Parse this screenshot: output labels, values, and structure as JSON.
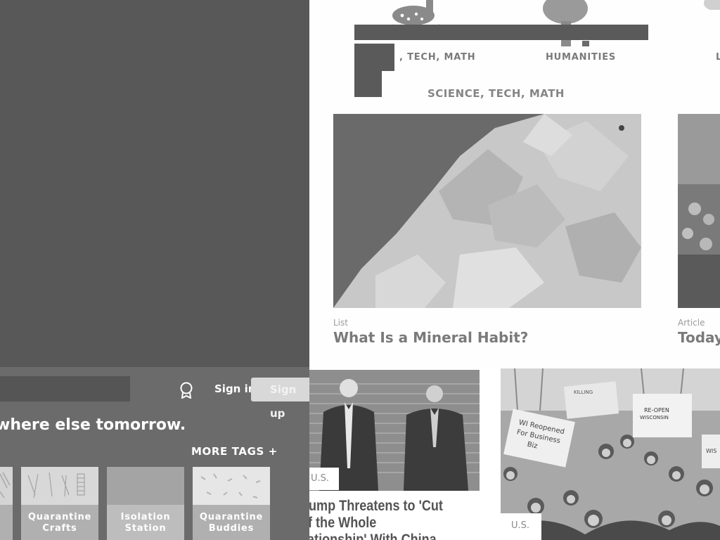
{
  "categories": [
    {
      "label": ", TECH, MATH"
    },
    {
      "label": "HUMANITIES"
    },
    {
      "label": "L"
    }
  ],
  "section_title": "SCIENCE, TECH, MATH",
  "cards": [
    {
      "type": "List",
      "title": "What Is a Mineral Habit?"
    },
    {
      "type": "Article",
      "title": "Today"
    }
  ],
  "bottom_header": {
    "sign_in": "Sign in",
    "sign_up": "Sign up",
    "tagline": "where else tomorrow.",
    "more_tags": "MORE TAGS +"
  },
  "tags": [
    {
      "label_line1": "",
      "label_line2": ""
    },
    {
      "label_line1": "Quarantine",
      "label_line2": "Crafts"
    },
    {
      "label_line1": "Isolation",
      "label_line2": "Station"
    },
    {
      "label_line1": "Quarantine",
      "label_line2": "Buddies"
    }
  ],
  "news": [
    {
      "tag": "U.S.",
      "title_line1": "rump Threatens to 'Cut",
      "title_line2": "ff the Whole",
      "title_line3": "lationship' With China"
    },
    {
      "tag": "U.S."
    }
  ],
  "news2_signs": [
    "RE-OPEN",
    "WISCONSIN",
    "KILLING",
    "WI Reopened",
    "For Business",
    "Biz",
    "WIS"
  ]
}
